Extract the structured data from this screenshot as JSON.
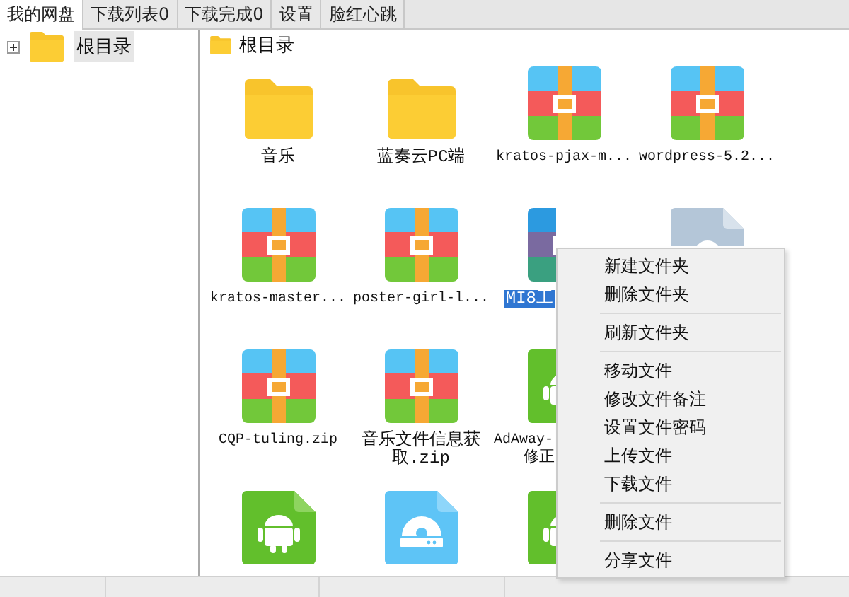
{
  "tabs": [
    {
      "label": "我的网盘",
      "selected": true
    },
    {
      "label": "下载列表0",
      "selected": false
    },
    {
      "label": "下载完成0",
      "selected": false
    },
    {
      "label": "设置",
      "selected": false
    },
    {
      "label": "脸红心跳",
      "selected": false
    }
  ],
  "tree": {
    "items": [
      {
        "label": "根目录",
        "expanded": false,
        "selected": true
      }
    ]
  },
  "path": "根目录",
  "file_rows": [
    [
      {
        "kind": "folder",
        "label": "音乐",
        "selected": false
      },
      {
        "kind": "folder",
        "label": "蓝奏云PC端",
        "selected": false
      },
      {
        "kind": "archive",
        "label": "kratos-pjax-m...",
        "selected": false
      },
      {
        "kind": "archive",
        "label": "wordpress-5.2...",
        "selected": false
      }
    ],
    [
      {
        "kind": "archive",
        "label": "kratos-master...",
        "selected": false
      },
      {
        "kind": "archive",
        "label": "poster-girl-l...",
        "selected": false
      },
      {
        "kind": "archive",
        "label": "MI8工",
        "selected": true,
        "covered_right": true
      },
      {
        "kind": "document",
        "selected": false,
        "covered_bottom": true
      }
    ],
    [
      {
        "kind": "archive",
        "label": "CQP-tuling.zip",
        "selected": false
      },
      {
        "kind": "archive",
        "label": "音乐文件信息获取.zip",
        "selected": false
      },
      {
        "kind": "android",
        "label": "AdAway-",
        "label_2": "修正",
        "selected": false,
        "covered_right": true
      }
    ],
    [
      {
        "kind": "android",
        "selected": false
      },
      {
        "kind": "disc",
        "selected": false
      },
      {
        "kind": "android",
        "selected": false,
        "covered_right": true
      }
    ]
  ],
  "context_menu": {
    "groups": [
      [
        "新建文件夹",
        "删除文件夹"
      ],
      [
        "刷新文件夹"
      ],
      [
        "移动文件",
        "修改文件备注",
        "设置文件密码",
        "上传文件",
        "下载文件"
      ],
      [
        "删除文件"
      ],
      [
        "分享文件"
      ]
    ]
  }
}
